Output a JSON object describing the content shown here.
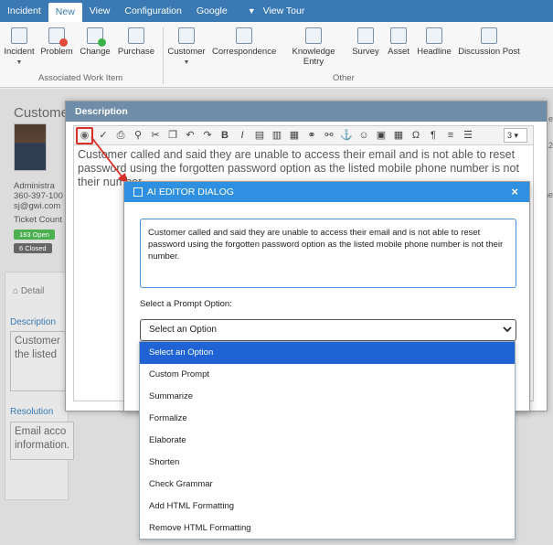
{
  "topnav": {
    "tabs": [
      "Incident",
      "New",
      "View",
      "Configuration",
      "Google",
      "View Tour"
    ],
    "active": "New"
  },
  "ribbon": {
    "incident_group": [
      "Incident",
      "Problem",
      "Change",
      "Purchase"
    ],
    "incident_group_label": "Associated Work Item",
    "other_group": [
      "Customer",
      "Correspondence",
      "Knowledge Entry",
      "Survey",
      "Asset",
      "Headline",
      "Discussion Post"
    ],
    "other_group_label": "Other"
  },
  "background": {
    "title": "Custome",
    "contact_lines": [
      "Administra",
      "360-397-100",
      "sj@gwi.com",
      "Ticket Count"
    ],
    "badges": [
      {
        "text": "183 Open",
        "color": "#4caf50"
      },
      {
        "text": "6 Closed",
        "color": "#666666"
      }
    ],
    "tab_label": "Detail",
    "description_label": "Description",
    "description_lines": [
      "Customer",
      "the listed"
    ],
    "resolution_label": "Resolution",
    "resolution_lines": [
      "Email acco",
      "information."
    ],
    "right_edge": [
      "e",
      "12",
      "he"
    ]
  },
  "description_modal": {
    "title": "Description",
    "font_size_value": "3",
    "body_text": "Customer called and said they are unable to access their email and is not able to reset password using the forgotten password option as the listed mobile phone number is not their number."
  },
  "ai_dialog": {
    "title": "AI EDITOR DIALOG",
    "close_label": "×",
    "input_text": "Customer called and said they are unable to access their email and is not able to reset password using the forgotten password option as the listed mobile phone number is not their number.",
    "prompt_label": "Select a Prompt Option:",
    "selected_value": "Select an Option",
    "options": [
      "Select an Option",
      "Custom Prompt",
      "Summarize",
      "Formalize",
      "Elaborate",
      "Shorten",
      "Check Grammar",
      "Add HTML Formatting",
      "Remove HTML Formatting"
    ]
  },
  "colors": {
    "nav": "#3a79b3",
    "dialog_header": "#2f8fe0",
    "highlight": "#1f63d4",
    "callout": "#d9302a"
  }
}
